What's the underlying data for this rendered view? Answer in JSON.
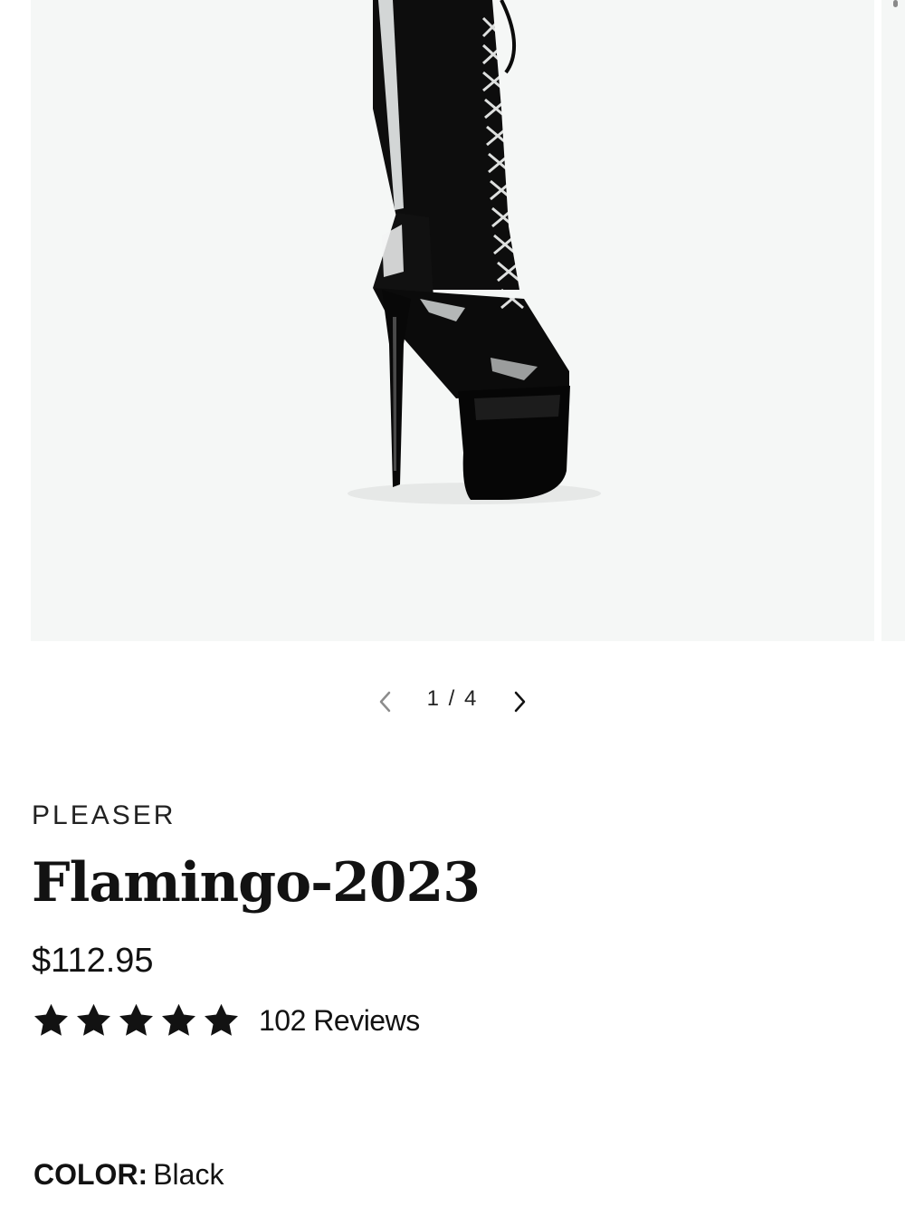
{
  "gallery": {
    "current": "1",
    "separator": "/",
    "total": "4",
    "image_alt": "Black patent lace-up knee boot with platform high heel"
  },
  "product": {
    "vendor": "PLEASER",
    "title": "Flamingo-2023",
    "price": "$112.95",
    "rating": 5,
    "rating_max": 5,
    "reviews_label": "102 Reviews"
  },
  "variant": {
    "label": "COLOR:",
    "value": "Black"
  },
  "colors": {
    "text": "#121212",
    "image_bg": "#f5f7f6",
    "star": "#121212"
  },
  "icons": {
    "prev": "chevron-left-icon",
    "next": "chevron-right-icon",
    "star": "star-icon"
  }
}
